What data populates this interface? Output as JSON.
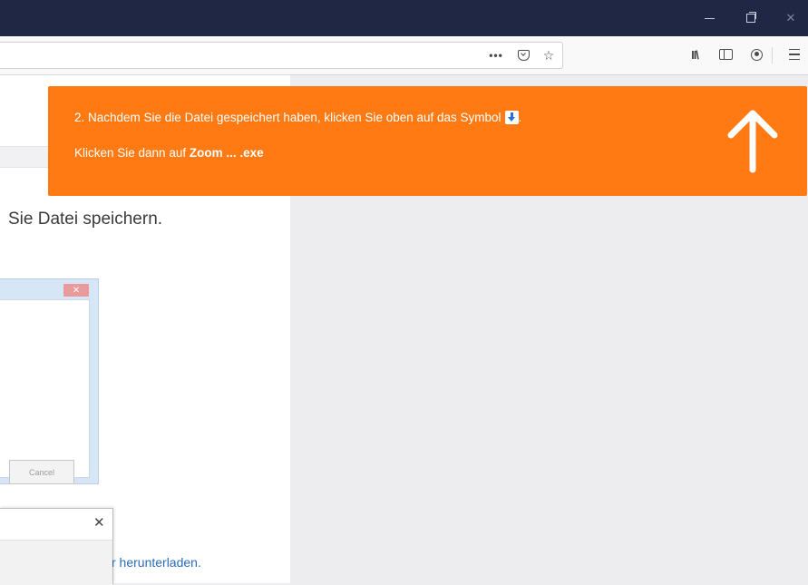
{
  "window": {
    "min_icon": "minimize-icon",
    "max_icon": "restore-icon",
    "close_icon": "close-icon",
    "close_glyph": "✕"
  },
  "toolbar": {
    "page_actions": "•••",
    "icons": [
      "page-actions-icon",
      "pocket-icon",
      "bookmark-star-icon",
      "library-icon",
      "sidebar-icon",
      "account-icon",
      "menu-icon"
    ],
    "star_glyph": "☆",
    "library_glyph": "II\\"
  },
  "banner": {
    "line1_text": "2. Nachdem Sie die Datei gespeichert haben, klicken Sie oben auf das Symbol",
    "line1_suffix": ".",
    "line2_prefix": "Klicken Sie dann auf ",
    "line2_bold": "Zoom ... .exe",
    "background": "#ff7a12",
    "arrow_icon": "arrow-up-icon"
  },
  "content": {
    "save_instruction": "Sie Datei speichern.",
    "dialog_close_glyph": "✕",
    "dialog_cancel_label": "Cancel",
    "popup_close_glyph": "✕",
    "download_link": "r herunterladen."
  }
}
